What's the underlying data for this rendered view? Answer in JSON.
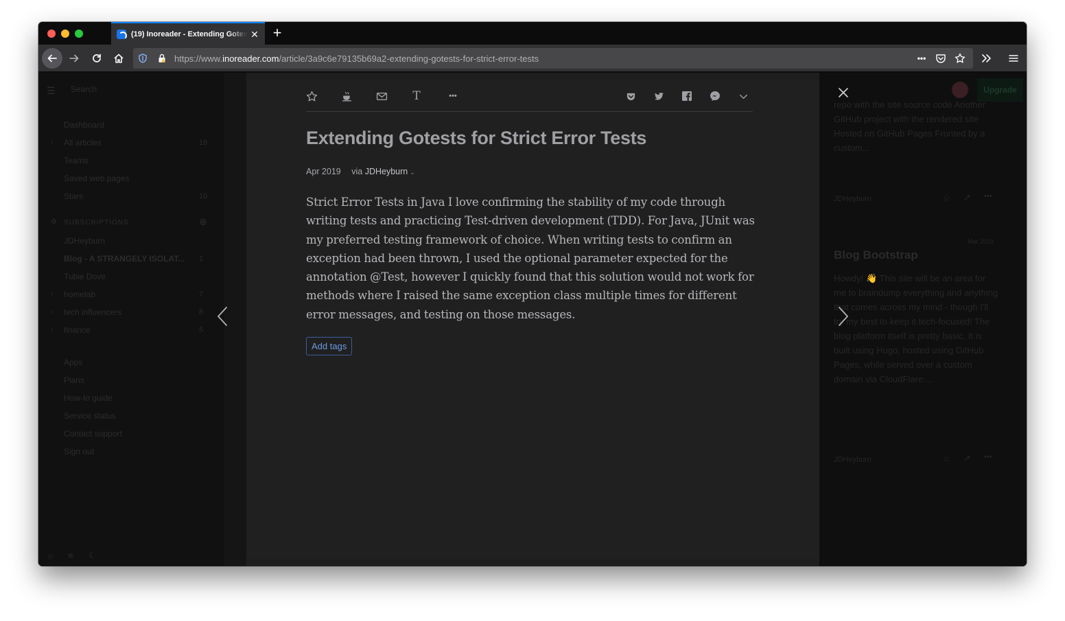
{
  "browser": {
    "tab_title": "(19) Inoreader - Extending Gotests for Strict Error Tests",
    "url_prefix": "https://www.",
    "url_domain": "inoreader.com",
    "url_path": "/article/3a9c6e79135b69a2-extending-gotests-for-strict-error-tests",
    "page_actions_label": "•••"
  },
  "sidebar": {
    "search_placeholder": "Search",
    "nav": [
      {
        "label": "Dashboard",
        "count": ""
      },
      {
        "label": "All articles",
        "count": "19"
      },
      {
        "label": "Teams",
        "count": ""
      },
      {
        "label": "Saved web pages",
        "count": ""
      },
      {
        "label": "Stars",
        "count": "10"
      }
    ],
    "subscriptions_header": "SUBSCRIPTIONS",
    "feeds": [
      {
        "label": "JDHeyburn",
        "count": ""
      },
      {
        "label": "Blog - A STRANGELY ISOLAT...",
        "count": "1"
      },
      {
        "label": "Tubie Dove",
        "count": ""
      },
      {
        "label": "homelab",
        "count": "7"
      },
      {
        "label": "tech influencers",
        "count": "8"
      },
      {
        "label": "finance",
        "count": "5"
      }
    ],
    "links": [
      "Apps",
      "Plans",
      "How-to guide",
      "Service status",
      "Contact support",
      "Sign out"
    ]
  },
  "right_panel": {
    "upgrade_label": "Upgrade",
    "card1_text": "repo with the site source code Another GitHub project with the rendered site Hosted on GitHub Pages Fronted by a custom...",
    "card1_author": "JDHeyburn",
    "card2_date": "Mar 2019",
    "card2_title": "Blog Bootstrap",
    "card2_text": "Howdy! 👋 This site will be an area for me to braindump everything and anything that comes across my mind - though I'll try my best to keep it tech-focused! The blog platform itself is pretty basic. It is built using Hugo, hosted using GitHub Pages, while served over a custom domain via CloudFlare....",
    "card2_author": "JDHeyburn"
  },
  "article": {
    "title": "Extending Gotests for Strict Error Tests",
    "date": "Apr 2019",
    "via_label": "via",
    "author": "JDHeyburn",
    "body": "Strict Error Tests in Java I love confirming the stability of my code through writing tests and practicing Test-driven development (TDD). For Java, JUnit was my preferred testing framework of choice. When writing tests to confirm an exception had been thrown, I used the optional parameter expected for the annotation @Test, however I quickly found that this solution would not work for methods where I raised the same exception class multiple times for different error messages, and testing on those messages.",
    "add_tags_label": "Add tags",
    "text_size_label": "T",
    "more_label": "•••"
  },
  "colors": {
    "link_blue": "#6a9be0",
    "tab_accent": "#0a84ff"
  }
}
